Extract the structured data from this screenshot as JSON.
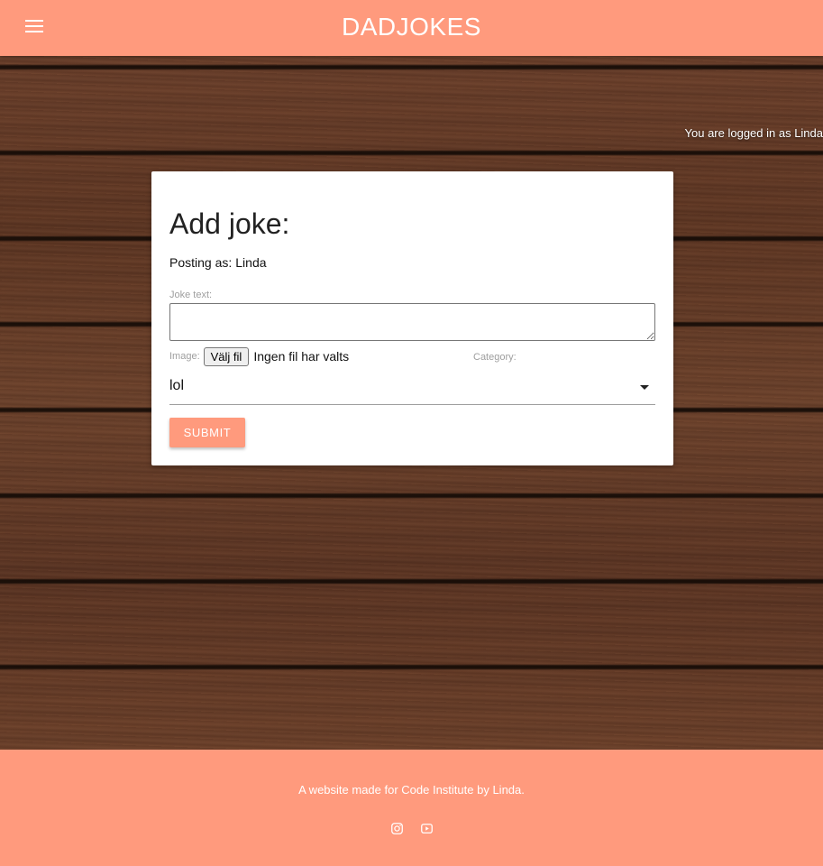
{
  "navbar": {
    "brand": "DADJOKES",
    "menu_icon": "hamburger-menu-icon"
  },
  "status": {
    "logged_in_text": "You are logged in as Linda"
  },
  "form": {
    "title": "Add joke:",
    "posting_label": "Posting as:",
    "posting_user": "Linda",
    "joke_text_label": "Joke text:",
    "joke_text_value": "",
    "image_label": "Image:",
    "file_button_label": "Välj fil",
    "file_status": "Ingen fil har valts",
    "category_label": "Category:",
    "category_value": "lol",
    "submit_label": "SUBMIT"
  },
  "footer": {
    "text": "A website made for Code Institute by Linda.",
    "icons": [
      "instagram-icon",
      "youtube-icon"
    ]
  },
  "colors": {
    "accent": "#ff9a7d",
    "card": "#ffffff"
  }
}
